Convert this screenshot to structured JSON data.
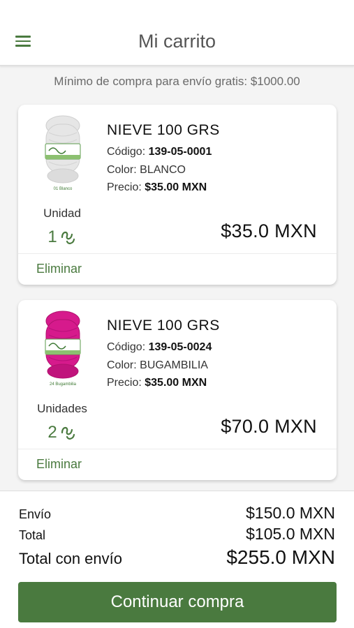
{
  "header": {
    "title": "Mi carrito",
    "menu_icon": "hamburger-menu-icon"
  },
  "notice": "Mínimo de compra para envío gratis: $1000.00",
  "labels": {
    "code": "Código:",
    "color": "Color:",
    "price": "Precio:",
    "remove": "Eliminar"
  },
  "items": [
    {
      "name": "NIEVE 100 GRS",
      "code": "139-05-0001",
      "color": "BLANCO",
      "unit_price": "$35.00 MXN",
      "unit_label": "Unidad",
      "quantity": "1",
      "total": "$35.0 MXN",
      "image_color": "#e6e6e6",
      "image_caption": "01 Blanco"
    },
    {
      "name": "NIEVE 100 GRS",
      "code": "139-05-0024",
      "color": "BUGAMBILIA",
      "unit_price": "$35.00 MXN",
      "unit_label": "Unidades",
      "quantity": "2",
      "total": "$70.0 MXN",
      "image_color": "#d61a8c",
      "image_caption": "24 Bugambilia"
    }
  ],
  "summary": {
    "shipping_label": "Envío",
    "shipping_value": "$150.0 MXN",
    "total_label": "Total",
    "total_value": "$105.0 MXN",
    "grand_label": "Total con envío",
    "grand_value": "$255.0 MXN"
  },
  "continue_label": "Continuar compra",
  "colors": {
    "accent": "#4a7a3f"
  }
}
